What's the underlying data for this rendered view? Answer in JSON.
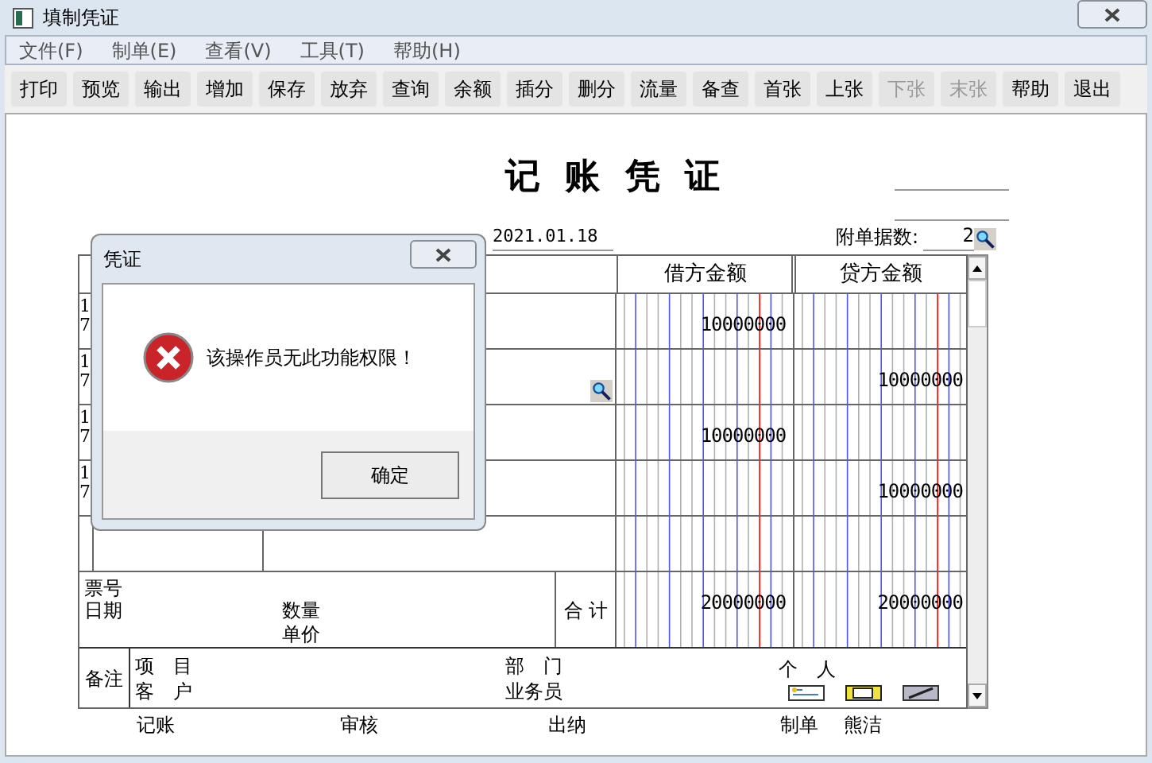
{
  "window": {
    "title": "填制凭证"
  },
  "menu": [
    {
      "label": "文件(F)"
    },
    {
      "label": "制单(E)"
    },
    {
      "label": "查看(V)"
    },
    {
      "label": "工具(T)"
    },
    {
      "label": "帮助(H)"
    }
  ],
  "toolbar": [
    {
      "label": "打印",
      "disabled": false
    },
    {
      "label": "预览",
      "disabled": false
    },
    {
      "label": "输出",
      "disabled": false
    },
    {
      "label": "增加",
      "disabled": false
    },
    {
      "label": "保存",
      "disabled": false
    },
    {
      "label": "放弃",
      "disabled": false
    },
    {
      "label": "查询",
      "disabled": false
    },
    {
      "label": "余额",
      "disabled": false
    },
    {
      "label": "插分",
      "disabled": false
    },
    {
      "label": "删分",
      "disabled": false
    },
    {
      "label": "流量",
      "disabled": false
    },
    {
      "label": "备查",
      "disabled": false
    },
    {
      "label": "首张",
      "disabled": false
    },
    {
      "label": "上张",
      "disabled": false
    },
    {
      "label": "下张",
      "disabled": true
    },
    {
      "label": "末张",
      "disabled": true
    },
    {
      "label": "帮助",
      "disabled": false
    },
    {
      "label": "退出",
      "disabled": false
    }
  ],
  "voucher": {
    "title": "记 账 凭 证",
    "date": "2021.01.18",
    "attachments_label": "附单据数:",
    "attachments": "2",
    "debit_header": "借方金额",
    "credit_header": "贷方金额",
    "rows": [
      {
        "index": "17",
        "debit": "10000000",
        "credit": ""
      },
      {
        "index": "17",
        "debit": "",
        "credit": "10000000"
      },
      {
        "index": "17",
        "debit": "10000000",
        "credit": ""
      },
      {
        "index": "17",
        "debit": "",
        "credit": "10000000"
      }
    ],
    "totals": {
      "ticket_label": "票号",
      "date_label": "日期",
      "quantity_label": "数量",
      "price_label": "单价",
      "total_label": "合 计",
      "debit": "20000000",
      "credit": "20000000"
    },
    "remarks": {
      "label": "备注",
      "project_label": "项　目",
      "customer_label": "客　户",
      "department_label": "部　门",
      "salesperson_label": "业务员",
      "person_label": "个　人"
    },
    "signatures": [
      {
        "label": "记账"
      },
      {
        "label": "审核"
      },
      {
        "label": "出纳"
      },
      {
        "label": "制单",
        "value": "熊洁"
      }
    ]
  },
  "dialog": {
    "title": "凭证",
    "message": "该操作员无此功能权限！",
    "button": "确定"
  }
}
